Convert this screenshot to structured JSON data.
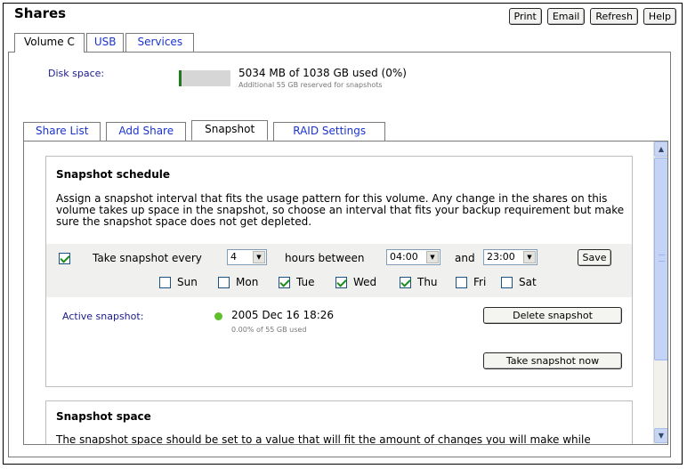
{
  "header": {
    "title": "Shares",
    "buttons": {
      "print": "Print",
      "email": "Email",
      "refresh": "Refresh",
      "help": "Help"
    }
  },
  "volume_tabs": [
    {
      "label": "Volume C",
      "active": true
    },
    {
      "label": "USB",
      "active": false
    },
    {
      "label": "Services",
      "active": false
    }
  ],
  "disk": {
    "label": "Disk space:",
    "usage_text": "5034 MB of 1038 GB used (0%)",
    "reserved_text": "Additional 55 GB reserved for snapshots",
    "used_fraction": 0.0,
    "bar_color": "#1d7a1d"
  },
  "share_tabs": [
    {
      "label": "Share List",
      "active": false
    },
    {
      "label": "Add Share",
      "active": false
    },
    {
      "label": "Snapshot",
      "active": true
    },
    {
      "label": "RAID Settings",
      "active": false
    }
  ],
  "schedule": {
    "title": "Snapshot schedule",
    "description": "Assign a snapshot interval that fits the usage pattern for this volume. Any change in the shares on this volume takes up space in the snapshot, so choose an interval that fits your backup requirement but make sure the snapshot space does not get depleted.",
    "take_every_label": "Take snapshot every",
    "take_every_checked": true,
    "interval_value": "4",
    "hours_between_label": "hours between",
    "start_time": "04:00",
    "and_label": "and",
    "end_time": "23:00",
    "save_label": "Save",
    "days": [
      {
        "label": "Sun",
        "checked": false
      },
      {
        "label": "Mon",
        "checked": false
      },
      {
        "label": "Tue",
        "checked": true
      },
      {
        "label": "Wed",
        "checked": true
      },
      {
        "label": "Thu",
        "checked": true
      },
      {
        "label": "Fri",
        "checked": false
      },
      {
        "label": "Sat",
        "checked": false
      }
    ],
    "active_label": "Active snapshot:",
    "active_date": "2005 Dec 16 18:26",
    "active_status_color": "#5fbf2a",
    "active_usage": "0.00% of 55 GB used",
    "delete_label": "Delete snapshot",
    "take_now_label": "Take snapshot now"
  },
  "space": {
    "title": "Snapshot space",
    "description": "The snapshot space should be set to a value that will fit the amount of changes you will make while"
  }
}
